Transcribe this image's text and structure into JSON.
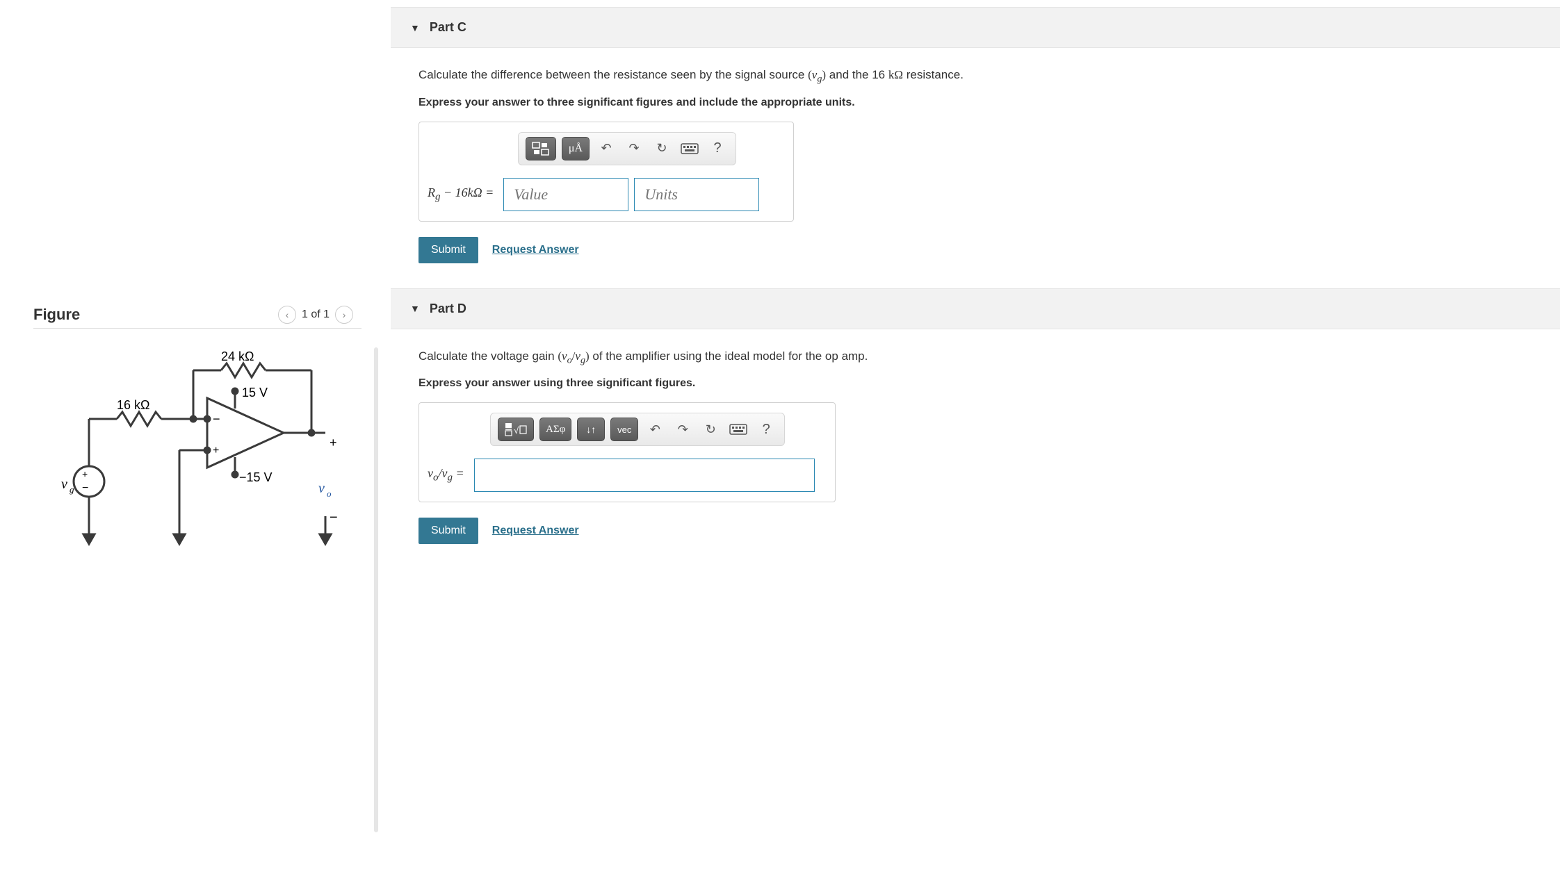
{
  "figure": {
    "title": "Figure",
    "pager": "1 of 1",
    "labels": {
      "r1": "16 kΩ",
      "r2": "24 kΩ",
      "vplus": "15 V",
      "vminus": "−15 V",
      "vg": "vg",
      "vo": "vo"
    }
  },
  "partC": {
    "header": "Part C",
    "prompt_prefix": "Calculate the difference between the resistance seen by the signal source ",
    "prompt_var": "(v_g)",
    "prompt_mid": " and the 16 ",
    "prompt_unit": "kΩ",
    "prompt_suffix": " resistance.",
    "instruction": "Express your answer to three significant figures and include the appropriate units.",
    "eq_label": "R_g − 16kΩ =",
    "value_placeholder": "Value",
    "units_placeholder": "Units",
    "submit": "Submit",
    "request": "Request Answer",
    "toolbar": {
      "ua": "μÅ",
      "help": "?"
    }
  },
  "partD": {
    "header": "Part D",
    "prompt_prefix": "Calculate the voltage gain ",
    "prompt_var": "(v_o/v_g)",
    "prompt_suffix": " of the amplifier using the ideal model for the op amp.",
    "instruction": "Express your answer using three significant figures.",
    "eq_label": "v_o/v_g =",
    "submit": "Submit",
    "request": "Request Answer",
    "toolbar": {
      "greek": "ΑΣφ",
      "updown": "↓↑",
      "vec": "vec",
      "help": "?"
    }
  }
}
